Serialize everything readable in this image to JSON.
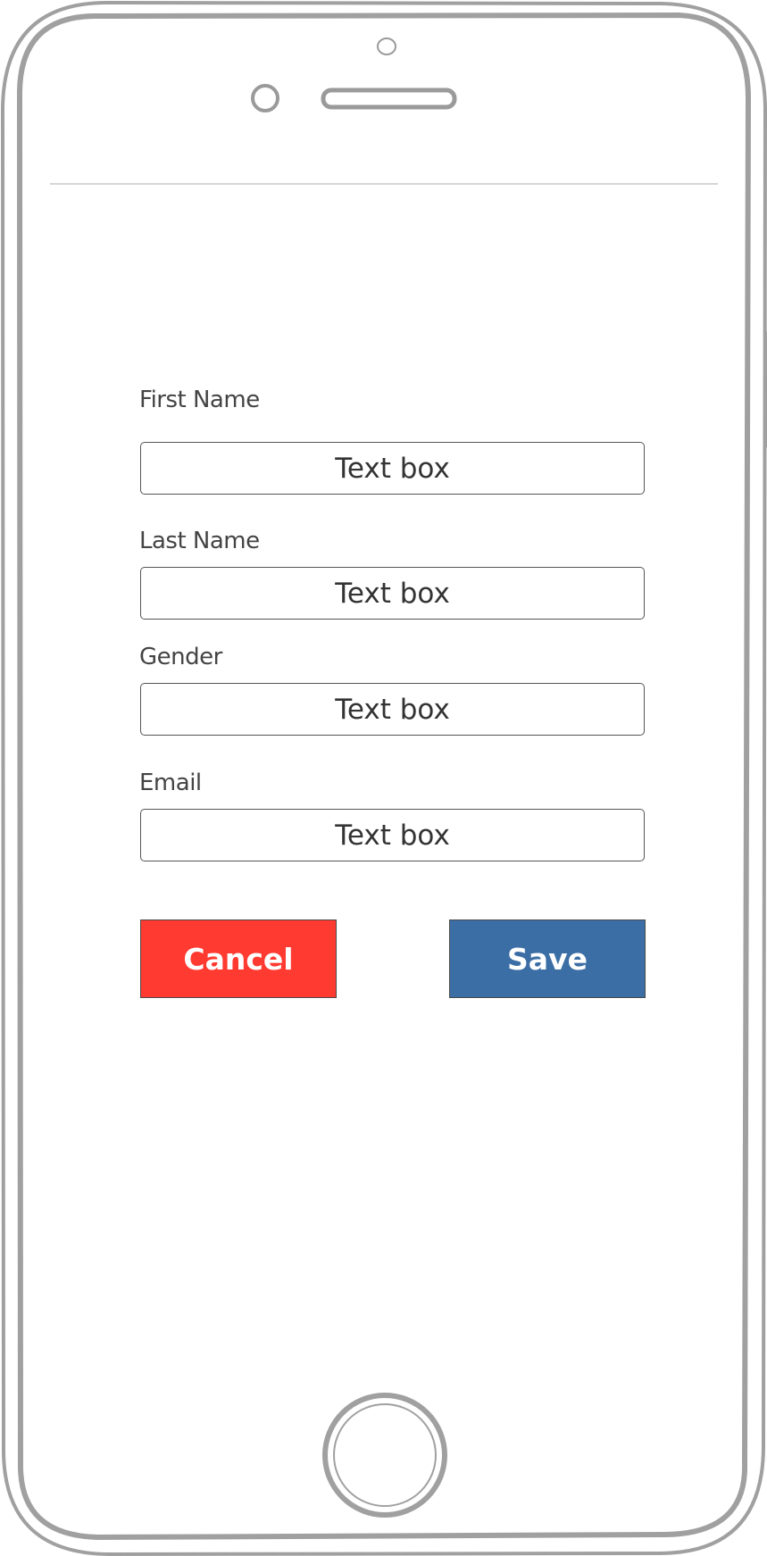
{
  "form": {
    "fields": [
      {
        "label": "First Name",
        "value": "Text box"
      },
      {
        "label": "Last Name",
        "value": "Text box"
      },
      {
        "label": "Gender",
        "value": "Text box"
      },
      {
        "label": "Email",
        "value": "Text box"
      }
    ]
  },
  "buttons": {
    "cancel_label": "Cancel",
    "save_label": "Save"
  },
  "colors": {
    "cancel": "#ff3a30",
    "save": "#3c6ea6",
    "frame": "#a0a0a0"
  }
}
